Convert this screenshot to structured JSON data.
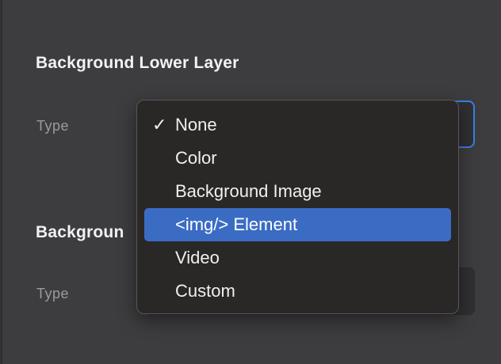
{
  "sections": [
    {
      "title": "Background Lower Layer",
      "type_label": "Type"
    },
    {
      "title": "Backgroun",
      "type_label": "Type"
    }
  ],
  "dropdown": {
    "options": [
      "None",
      "Color",
      "Background Image",
      "<img/> Element",
      "Video",
      "Custom"
    ],
    "checked_index": 0,
    "highlighted_index": 3,
    "check_icon": "checkmark-icon",
    "check_glyph": "✓"
  },
  "colors": {
    "panel_bg": "#3d3d3f",
    "menu_bg": "#2a2727",
    "highlight": "#3b6cc4",
    "focus_border": "#3a7ee8"
  }
}
